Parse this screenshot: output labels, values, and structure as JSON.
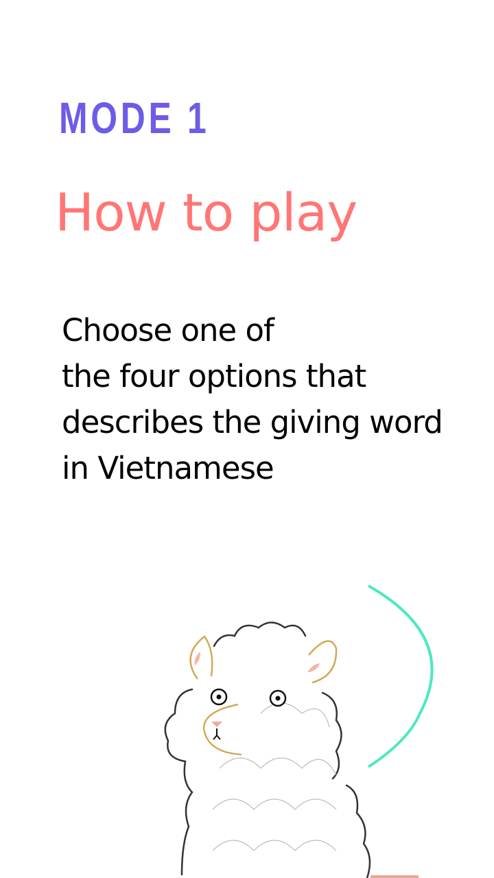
{
  "header": {
    "mode_label": "MODE 1",
    "title": "How to play"
  },
  "instructions": {
    "lines": [
      "Choose one of",
      "the four options that",
      "describes the giving word",
      "in Vietnamese"
    ]
  },
  "colors": {
    "mode": "#6c5ce7",
    "title": "#ff7675",
    "arc": "#4de8c2",
    "text": "#000000"
  },
  "illustration": {
    "icon": "sheep-illustration"
  }
}
